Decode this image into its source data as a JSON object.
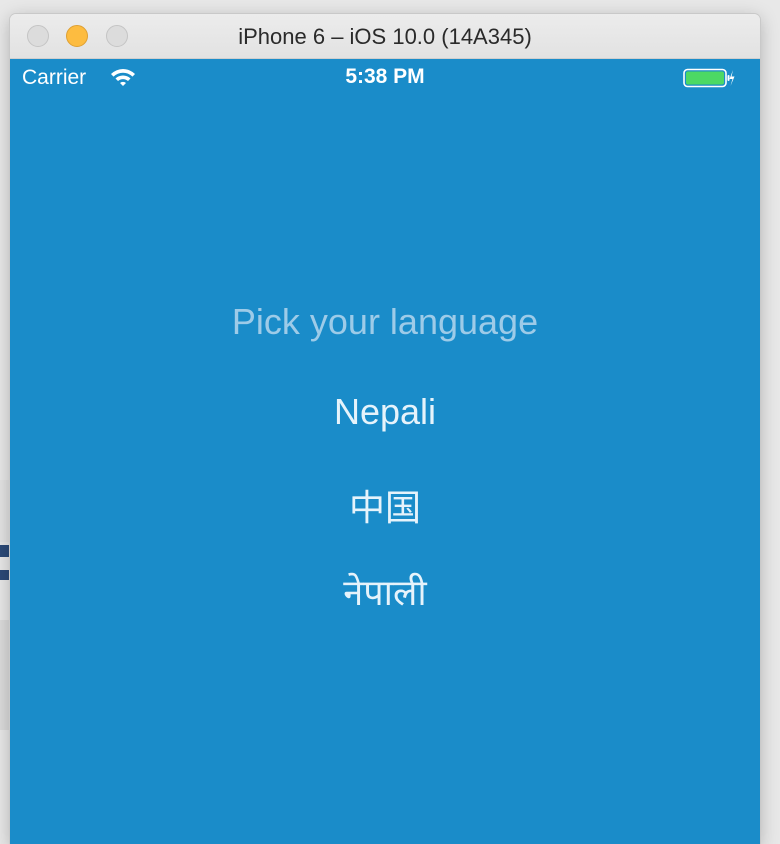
{
  "window": {
    "title": "iPhone 6 – iOS 10.0 (14A345)",
    "controls": [
      "close",
      "minimize",
      "zoom"
    ]
  },
  "status_bar": {
    "carrier": "Carrier",
    "wifi_icon": "wifi-icon",
    "time": "5:38 PM",
    "battery_icon": "battery-charging-icon"
  },
  "screen": {
    "background_color": "#1a8cc9",
    "prompt": "Pick your language",
    "languages": [
      {
        "label": "Nepali"
      },
      {
        "label": "中国"
      },
      {
        "label": "नेपाली"
      }
    ]
  }
}
